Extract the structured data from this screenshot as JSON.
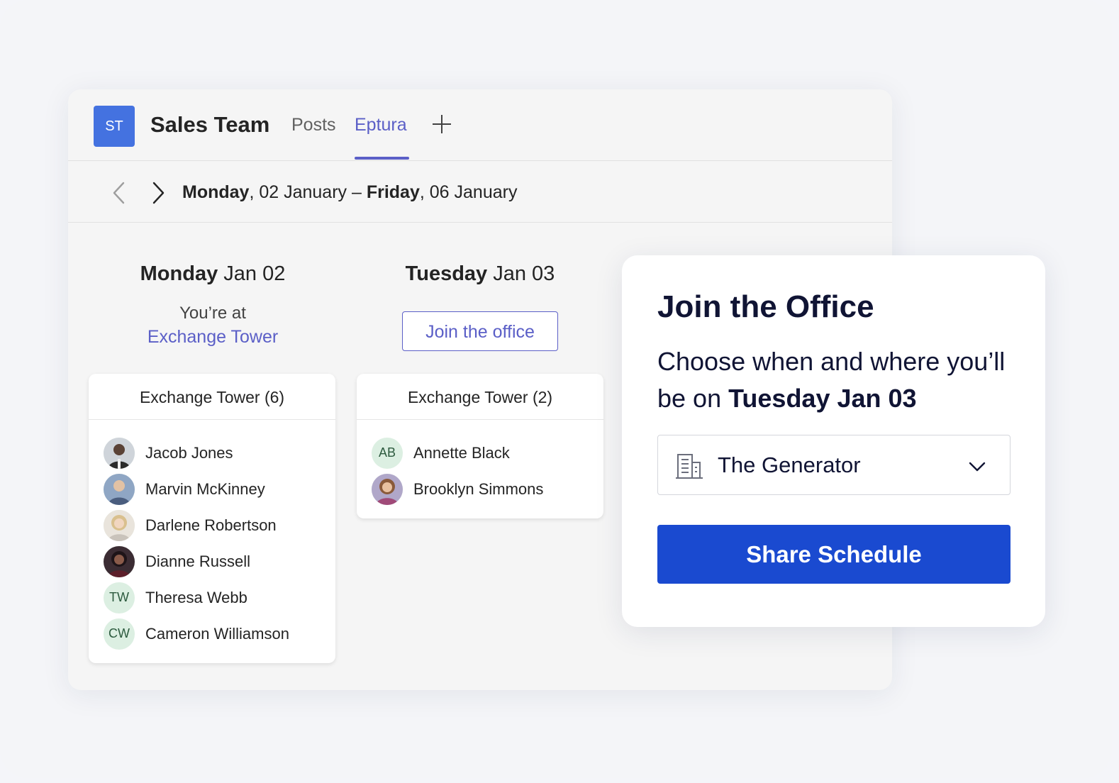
{
  "colors": {
    "brand_purple": "#5b5fc7",
    "team_avatar_blue": "#4472e0",
    "primary_button_blue": "#1a4ad0",
    "initials_avatar_bg": "#dcefe2"
  },
  "header": {
    "team_initials": "ST",
    "team_name": "Sales Team",
    "tabs": [
      {
        "label": "Posts",
        "active": false
      },
      {
        "label": "Eptura",
        "active": true
      }
    ],
    "add_tab_icon": "plus-icon"
  },
  "date_nav": {
    "prev_icon": "chevron-left-icon",
    "next_icon": "chevron-right-icon",
    "start_day": "Monday",
    "start_date": ", 02 January – ",
    "end_day": "Friday",
    "end_date": ", 06 January"
  },
  "days": [
    {
      "weekday": "Monday",
      "date": " Jan 02",
      "status_text": "You’re at",
      "status_location": "Exchange Tower",
      "location_card": {
        "title": "Exchange Tower (6)",
        "people": [
          {
            "name": "Jacob Jones",
            "avatar": "photo"
          },
          {
            "name": "Marvin McKinney",
            "avatar": "photo"
          },
          {
            "name": "Darlene Robertson",
            "avatar": "photo"
          },
          {
            "name": "Dianne Russell",
            "avatar": "photo"
          },
          {
            "name": "Theresa Webb",
            "initials": "TW"
          },
          {
            "name": "Cameron Williamson",
            "initials": "CW"
          }
        ]
      }
    },
    {
      "weekday": "Tuesday",
      "date": " Jan 03",
      "join_button_label": "Join the office",
      "location_card": {
        "title": "Exchange Tower (2)",
        "people": [
          {
            "name": "Annette Black",
            "initials": "AB"
          },
          {
            "name": "Brooklyn Simmons",
            "avatar": "photo"
          }
        ]
      }
    }
  ],
  "popover": {
    "title": "Join the Office",
    "description_prefix": "Choose when and where you’ll be on ",
    "description_day": "Tuesday Jan 03",
    "location_select": {
      "icon": "building-icon",
      "selected_value": "The Generator",
      "dropdown_icon": "chevron-down-icon"
    },
    "share_button_label": "Share Schedule"
  }
}
